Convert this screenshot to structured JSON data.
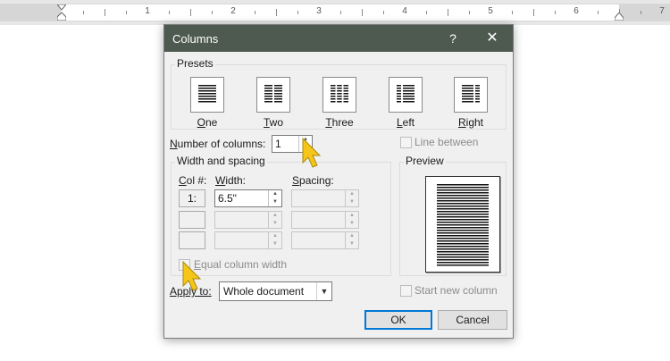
{
  "ruler": {
    "numbers": [
      "1",
      "2",
      "3",
      "4",
      "5",
      "6",
      "7"
    ]
  },
  "dialog": {
    "title": "Columns",
    "help_label": "?",
    "close_label": "✕",
    "presets": {
      "legend": "Presets",
      "items": [
        {
          "label_u": "O",
          "label_rest": "ne"
        },
        {
          "label_u": "T",
          "label_rest": "wo"
        },
        {
          "label_u": "T",
          "label_rest": "hree"
        },
        {
          "label_u": "L",
          "label_rest": "eft"
        },
        {
          "label_u": "R",
          "label_rest": "ight"
        }
      ]
    },
    "number_of_columns": {
      "label_u": "N",
      "label_rest": "umber of columns:",
      "value": "1"
    },
    "line_between": {
      "label": "Line between"
    },
    "width_spacing": {
      "legend": "Width and spacing",
      "col_header_u": "C",
      "col_header_rest": "ol #:",
      "width_header_u": "W",
      "width_header_rest": "idth:",
      "spacing_header_u": "S",
      "spacing_header_rest": "pacing:",
      "rows": [
        {
          "col": "1:",
          "width": "6.5\"",
          "spacing": ""
        },
        {
          "col": "",
          "width": "",
          "spacing": ""
        },
        {
          "col": "",
          "width": "",
          "spacing": ""
        }
      ],
      "equal_width": {
        "label_u": "E",
        "label_rest": "qual column width"
      }
    },
    "preview": {
      "legend": "Preview"
    },
    "apply_to": {
      "label_u": "Apply to:",
      "label_rest": "",
      "value": "Whole document"
    },
    "start_new_column": {
      "label": "Start new column"
    },
    "ok_label": "OK",
    "cancel_label": "Cancel"
  },
  "colors": {
    "titlebar": "#4e5a4f",
    "primary_border": "#0078d7",
    "cursor": "#f5c518"
  }
}
